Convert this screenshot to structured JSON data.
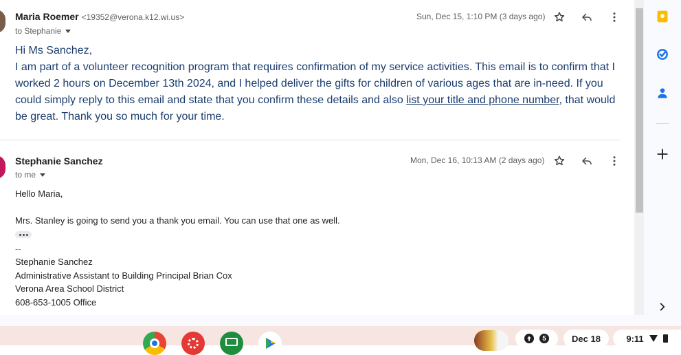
{
  "message1": {
    "sender_name": "Maria Roemer",
    "sender_email": "<19352@verona.k12.wi.us>",
    "to_line": "to Stephanie",
    "date": "Sun, Dec 15, 1:10 PM (3 days ago)",
    "greeting": "Hi Ms Sanchez,",
    "body_start": "I am part of a volunteer recognition program that requires confirmation of my service activities. This email is to confirm that I worked 2 hours on December 13th 2024, and I helped deliver the gifts for children of various ages that are in-need. If you could simply reply to this email and state that you confirm these details and also ",
    "body_link": "list your title and phone number",
    "body_end": ", that would be great. Thank you so much for your time.",
    "avatar_color": "#7a5c4a"
  },
  "message2": {
    "sender_name": "Stephanie Sanchez",
    "to_line": "to me",
    "date": "Mon, Dec 16, 10:13 AM (2 days ago)",
    "greeting": "Hello Maria,",
    "line1": "Mrs. Stanley is going to send you a thank you email. You can use that one as well.",
    "sig_dash": "--",
    "sig_name": "Stephanie Sanchez",
    "sig_title": "Administrative Assistant to Building Principal Brian Cox",
    "sig_org": "Verona Area School District",
    "sig_phone": "608-653-1005 Office",
    "avatar_color": "#c2185b"
  },
  "side_panel": {
    "icons": [
      "keep-icon",
      "tasks-icon",
      "contacts-icon",
      "add-icon",
      "expand-chevron-icon"
    ]
  },
  "taskbar": {
    "apps": [
      "chrome-icon",
      "canvas-icon",
      "classroom-icon",
      "play-store-icon"
    ],
    "notification_count": "5",
    "date": "Dec 18",
    "time": "9:11"
  }
}
